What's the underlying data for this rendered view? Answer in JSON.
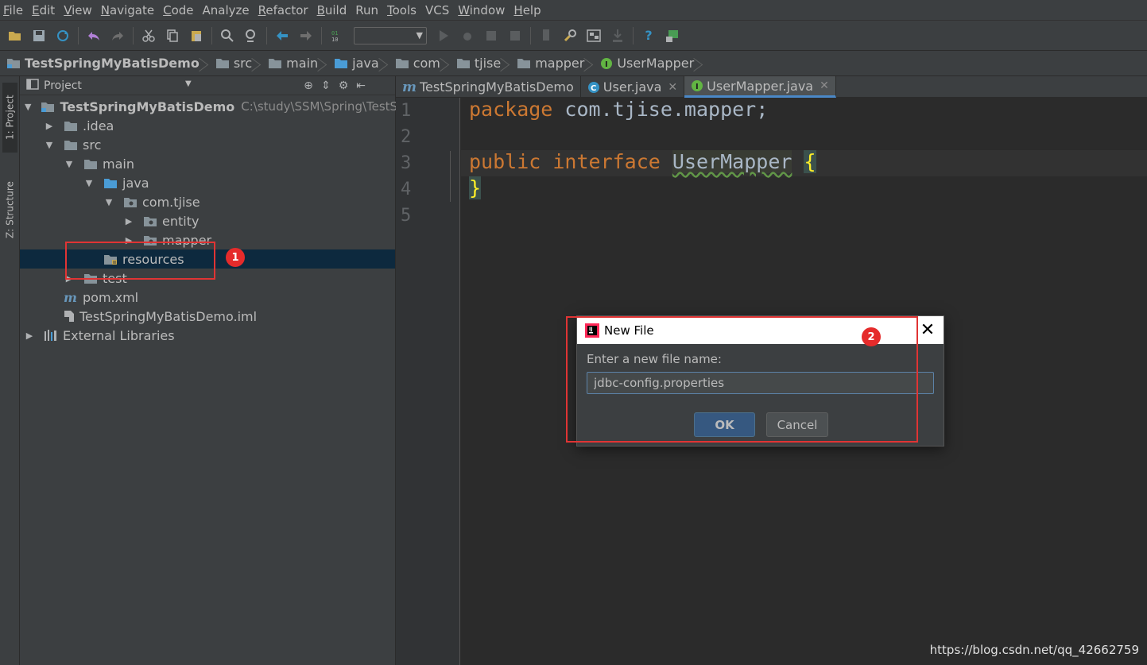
{
  "menu": [
    {
      "label": "File",
      "mnemonic": "F",
      "rest": "ile"
    },
    {
      "label": "Edit",
      "mnemonic": "E",
      "rest": "dit"
    },
    {
      "label": "View",
      "mnemonic": "V",
      "rest": "iew"
    },
    {
      "label": "Navigate",
      "mnemonic": "N",
      "rest": "avigate"
    },
    {
      "label": "Code",
      "mnemonic": "C",
      "rest": "ode"
    },
    {
      "label": "Analyze",
      "mnemonic": "",
      "rest": "Analyze"
    },
    {
      "label": "Refactor",
      "mnemonic": "R",
      "rest": "efactor"
    },
    {
      "label": "Build",
      "mnemonic": "B",
      "rest": "uild"
    },
    {
      "label": "Run",
      "mnemonic": "",
      "rest": "Run"
    },
    {
      "label": "Tools",
      "mnemonic": "T",
      "rest": "ools"
    },
    {
      "label": "VCS",
      "mnemonic": "",
      "rest": "VCS"
    },
    {
      "label": "Window",
      "mnemonic": "W",
      "rest": "indow"
    },
    {
      "label": "Help",
      "mnemonic": "H",
      "rest": "elp"
    }
  ],
  "breadcrumb": [
    "TestSpringMyBatisDemo",
    "src",
    "main",
    "java",
    "com",
    "tjise",
    "mapper",
    "UserMapper"
  ],
  "left_strip": {
    "project_tab": "1: Project",
    "structure_tab": "Z: Structure"
  },
  "project_panel": {
    "title": "Project",
    "tree": [
      {
        "label": "TestSpringMyBatisDemo",
        "path": "C:\\study\\SSM\\Spring\\TestSprin",
        "depth": 0,
        "expanded": true
      },
      {
        "label": ".idea",
        "depth": 1,
        "expanded": false
      },
      {
        "label": "src",
        "depth": 1,
        "expanded": true
      },
      {
        "label": "main",
        "depth": 2,
        "expanded": true
      },
      {
        "label": "java",
        "depth": 3,
        "expanded": true
      },
      {
        "label": "com.tjise",
        "depth": 4,
        "expanded": true
      },
      {
        "label": "entity",
        "depth": 5,
        "expanded": false
      },
      {
        "label": "mapper",
        "depth": 5,
        "expanded": false
      },
      {
        "label": "resources",
        "depth": 3,
        "selected": true
      },
      {
        "label": "test",
        "depth": 2,
        "expanded": false
      },
      {
        "label": "pom.xml",
        "depth": 1
      },
      {
        "label": "TestSpringMyBatisDemo.iml",
        "depth": 1
      },
      {
        "label": "External Libraries",
        "depth": 0,
        "expanded": false
      }
    ]
  },
  "editor_tabs": [
    {
      "label": "TestSpringMyBatisDemo",
      "active": false
    },
    {
      "label": "User.java",
      "active": false
    },
    {
      "label": "UserMapper.java",
      "active": true
    }
  ],
  "editor": {
    "line_numbers": [
      "1",
      "2",
      "3",
      "4",
      "5"
    ],
    "line1_kw": "package",
    "line1_rest": " com.tjise.mapper;",
    "line3_kw1": "public",
    "line3_kw2": "interface",
    "line3_name": "UserMapper",
    "line3_brace": "{",
    "line4_brace": "}"
  },
  "annotations": {
    "badge1": "1",
    "badge2": "2"
  },
  "dialog": {
    "title": "New File",
    "label": "Enter a new file name:",
    "input_value": "jdbc-config.properties",
    "ok_label": "OK",
    "cancel_label": "Cancel",
    "close_glyph": "✕"
  },
  "watermark": "https://blog.csdn.net/qq_42662759",
  "colors": {
    "accent": "#4a88c7",
    "selection": "#0d293e",
    "keyword": "#cc7832",
    "annotation_red": "#e03434"
  }
}
